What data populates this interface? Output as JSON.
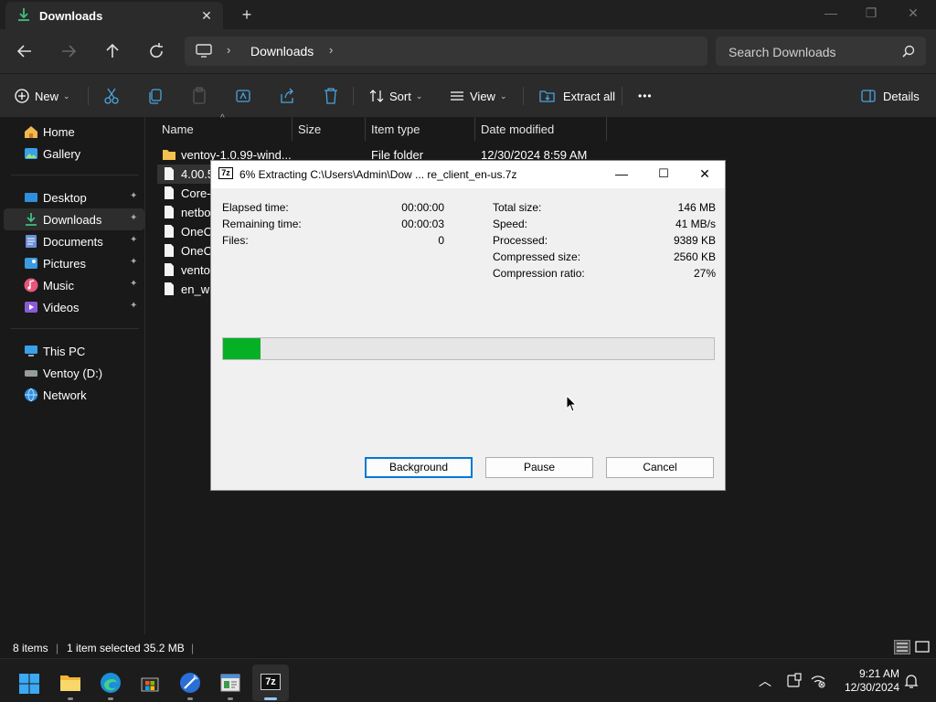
{
  "window": {
    "tab_title": "Downloads",
    "tab_close": "✕",
    "new_tab": "+",
    "min": "—",
    "max": "❐",
    "close": "✕"
  },
  "address": {
    "crumb": "Downloads",
    "sep": "›",
    "search_placeholder": "Search Downloads"
  },
  "commands": {
    "new": "New",
    "sort": "Sort",
    "view": "View",
    "extract_all": "Extract all",
    "more": "•••",
    "details": "Details"
  },
  "sidebar": {
    "items": [
      {
        "label": "Home",
        "icon": "home-icon"
      },
      {
        "label": "Gallery",
        "icon": "gallery-icon"
      },
      {
        "label": "Desktop",
        "icon": "desktop-folder-icon"
      },
      {
        "label": "Downloads",
        "icon": "downloads-folder-icon"
      },
      {
        "label": "Documents",
        "icon": "documents-folder-icon"
      },
      {
        "label": "Pictures",
        "icon": "pictures-folder-icon"
      },
      {
        "label": "Music",
        "icon": "music-folder-icon"
      },
      {
        "label": "Videos",
        "icon": "videos-folder-icon"
      },
      {
        "label": "This PC",
        "icon": "this-pc-icon"
      },
      {
        "label": "Ventoy (D:)",
        "icon": "drive-icon"
      },
      {
        "label": "Network",
        "icon": "network-icon"
      }
    ],
    "pin": "📌"
  },
  "filelist": {
    "columns": [
      "Name",
      "Size",
      "Item type",
      "Date modified"
    ],
    "rows": [
      {
        "name": "ventoy-1.0.99-wind...",
        "type": "File folder",
        "date": "12/30/2024 8:59 AM",
        "icon": "folder-icon"
      },
      {
        "name": "4.00.5",
        "type": "",
        "date": "",
        "icon": "file-icon"
      },
      {
        "name": "Core-",
        "type": "",
        "date": "",
        "icon": "file-icon"
      },
      {
        "name": "netbo",
        "type": "",
        "date": "",
        "icon": "file-icon"
      },
      {
        "name": "OneC",
        "type": "",
        "date": "",
        "icon": "file-icon"
      },
      {
        "name": "OneC",
        "type": "",
        "date": "",
        "icon": "file-icon"
      },
      {
        "name": "ventoy",
        "type": "",
        "date": "",
        "icon": "file-icon"
      },
      {
        "name": "en_wi",
        "type": "",
        "date": "",
        "icon": "file-icon"
      }
    ]
  },
  "status": {
    "items": "8 items",
    "selected": "1 item selected  35.2 MB",
    "sep": "|"
  },
  "dialog": {
    "title": "6% Extracting C:\\Users\\Admin\\Dow ... re_client_en-us.7z",
    "app_icon_text": "7z",
    "left": [
      {
        "label": "Elapsed time:",
        "value": "00:00:00"
      },
      {
        "label": "Remaining time:",
        "value": "00:00:03"
      },
      {
        "label": "Files:",
        "value": "0"
      }
    ],
    "right": [
      {
        "label": "Total size:",
        "value": "146 MB"
      },
      {
        "label": "Speed:",
        "value": "41 MB/s"
      },
      {
        "label": "Processed:",
        "value": "9389 KB"
      },
      {
        "label": "Compressed size:",
        "value": "2560 KB"
      },
      {
        "label": "Compression ratio:",
        "value": "27%"
      }
    ],
    "progress_fraction": 0.076,
    "buttons": {
      "background": "Background",
      "pause": "Pause",
      "cancel": "Cancel"
    }
  },
  "taskbar": {
    "apps": [
      "start-icon",
      "file-explorer-icon",
      "edge-icon",
      "store-icon",
      "app-icon",
      "notepad-icon",
      "seven-zip-icon"
    ],
    "time": "9:21 AM",
    "date": "12/30/2024",
    "seven_zip_label": "7z"
  },
  "colors": {
    "progress_green": "#06b025",
    "accent_blue": "#0078d7"
  }
}
